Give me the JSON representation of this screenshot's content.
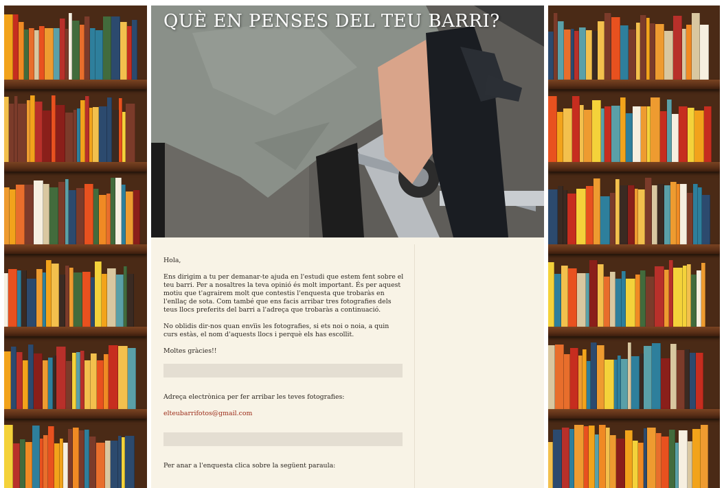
{
  "blog": {
    "title": "QUÈ EN PENSES DEL TEU BARRI?"
  },
  "post": {
    "greeting": "Hola,",
    "paragraph1": "Ens dirigim a tu per demanar-te ajuda en l'estudi que estem fent sobre el teu barri. Per a nosaltres la teva opinió és molt important. És per aquest motiu que t'agrairem molt que contestis l'enquesta que trobaràs en l'enllaç de sota. Com també que ens facis arribar tres fotografies dels teus llocs preferits del barri a l'adreça que trobaràs a continuació.",
    "paragraph2": "No oblidis dir-nos quan envïis les fotografies, si ets noi o noia, a quin curs estàs, el nom d'aquests llocs i perquè els has escollit.",
    "thanks": "Moltes gràcies!!",
    "email_label": "Adreça electrònica per fer arribar les teves fotografies:",
    "email": "elteubarrifotos@gmail.com",
    "survey_label": "Per anar a l'enquesta clica sobre la següent paraula:"
  },
  "colors": {
    "page_background": "#f8f3e6",
    "link": "#9b2a17",
    "shelf_wood": "#5a2f17"
  }
}
